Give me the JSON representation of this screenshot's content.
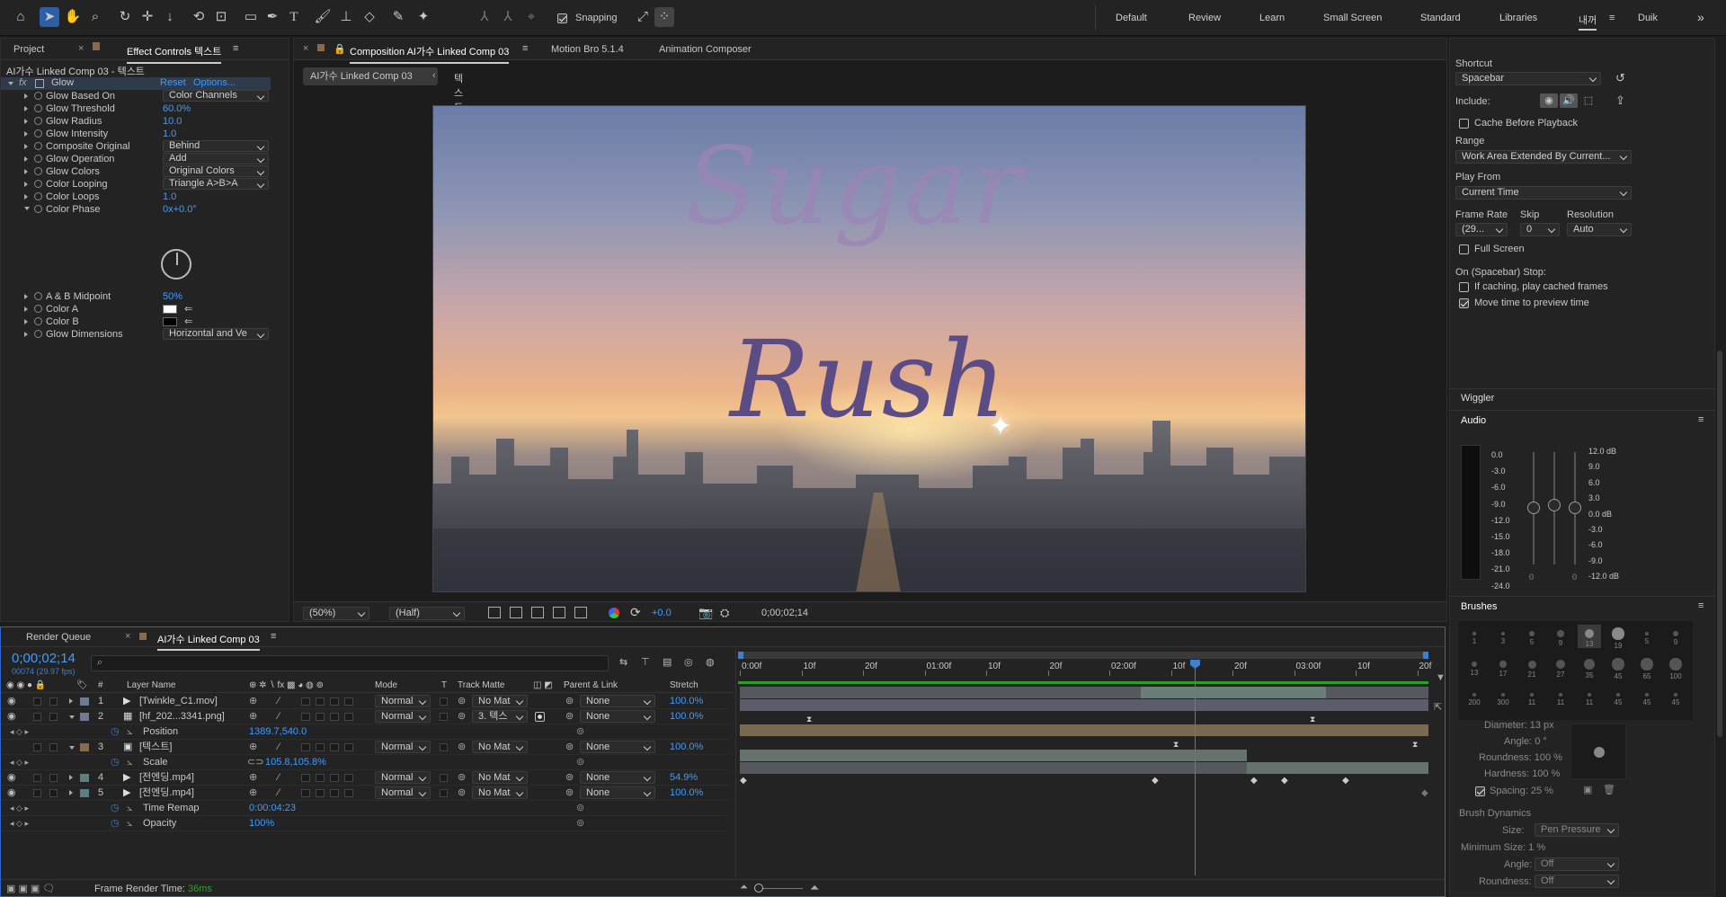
{
  "toolbar": {
    "snapping": "Snapping",
    "workspaces": [
      "Default",
      "Review",
      "Learn",
      "Small Screen",
      "Standard",
      "Libraries",
      "내꺼",
      "Duik"
    ],
    "more": "»"
  },
  "left": {
    "tab_project": "Project",
    "tab_ec": "Effect Controls 텍스트",
    "ec_title": "AI가수 Linked Comp 03 - 텍스트",
    "effect": "Glow",
    "reset": "Reset",
    "options": "Options...",
    "rows": [
      {
        "label": "Glow Based On",
        "value": "Color Channels",
        "type": "dd"
      },
      {
        "label": "Glow Threshold",
        "value": "60.0%",
        "type": "num"
      },
      {
        "label": "Glow Radius",
        "value": "10.0",
        "type": "num"
      },
      {
        "label": "Glow Intensity",
        "value": "1.0",
        "type": "num"
      },
      {
        "label": "Composite Original",
        "value": "Behind",
        "type": "dd"
      },
      {
        "label": "Glow Operation",
        "value": "Add",
        "type": "dd"
      },
      {
        "label": "Glow Colors",
        "value": "Original Colors",
        "type": "dd"
      },
      {
        "label": "Color Looping",
        "value": "Triangle A>B>A",
        "type": "dd"
      },
      {
        "label": "Color Loops",
        "value": "1.0",
        "type": "num"
      },
      {
        "label": "Color Phase",
        "value": "0x+0.0°",
        "type": "num"
      }
    ],
    "rows2": [
      {
        "label": "A & B Midpoint",
        "value": "50%",
        "type": "num"
      },
      {
        "label": "Color A",
        "value": "",
        "type": "colorA"
      },
      {
        "label": "Color B",
        "value": "",
        "type": "colorB"
      },
      {
        "label": "Glow Dimensions",
        "value": "Horizontal and Ve",
        "type": "dd"
      }
    ]
  },
  "comp": {
    "tab": "Composition AI가수 Linked Comp 03",
    "tab2": "Motion Bro 5.1.4",
    "tab3": "Animation Composer",
    "crumb1": "AI가수 Linked Comp 03",
    "crumb2": "텍스트",
    "text1": "Sugar",
    "text2": "Rush",
    "zoom": "(50%)",
    "res": "(Half)",
    "exposure": "+0.0",
    "timecode": "0;00;02;14"
  },
  "right": {
    "shortcut_label": "Shortcut",
    "shortcut": "Spacebar",
    "include": "Include:",
    "cache": "Cache Before Playback",
    "range_label": "Range",
    "range": "Work Area Extended By Current...",
    "playfrom_label": "Play From",
    "playfrom": "Current Time",
    "fr_label": "Frame Rate",
    "fr": "(29...",
    "skip_label": "Skip",
    "skip": "0",
    "resl_label": "Resolution",
    "resl": "Auto",
    "fullscreen": "Full Screen",
    "stop_label": "On (Spacebar) Stop:",
    "opt1": "If caching, play cached frames",
    "opt2": "Move time to preview time",
    "wiggler": "Wiggler",
    "audio": "Audio",
    "audio_left": [
      "0.0",
      "-3.0",
      "-6.0",
      "-9.0",
      "-12.0",
      "-15.0",
      "-18.0",
      "-21.0",
      "-24.0"
    ],
    "audio_right": [
      "12.0 dB",
      "9.0",
      "6.0",
      "3.0",
      "0.0 dB",
      "-3.0",
      "-6.0",
      "-9.0",
      "-12.0 dB"
    ],
    "audio_zero1": "0",
    "audio_zero2": "0",
    "brushes": "Brushes",
    "brush_sizes": [
      "1",
      "3",
      "5",
      "9",
      "13",
      "19",
      "5",
      "9",
      "13",
      "17",
      "21",
      "27",
      "35",
      "45",
      "65",
      "100",
      "200",
      "300",
      "11",
      "11",
      "11",
      "45",
      "45",
      "45"
    ],
    "diameter": "Diameter: 13 px",
    "angle": "Angle: 0 °",
    "roundness": "Roundness: 100 %",
    "hardness": "Hardness: 100 %",
    "spacing": "Spacing: 25 %",
    "dynamics": "Brush Dynamics",
    "size_label": "Size:",
    "size_val": "Pen Pressure",
    "minsize": "Minimum Size: 1 %",
    "angle_label": "Angle:",
    "angle_val": "Off",
    "round_label": "Roundness:",
    "round_val": "Off"
  },
  "timeline": {
    "tab_rq": "Render Queue",
    "tab_comp": "AI가수 Linked Comp 03",
    "timecode": "0;00;02;14",
    "fps": "00074 (29.97 fps)",
    "cols": {
      "num": "#",
      "name": "Layer Name",
      "mode": "Mode",
      "t": "T",
      "track": "Track Matte",
      "parent": "Parent & Link",
      "stretch": "Stretch"
    },
    "ruler": [
      "0:00f",
      "10f",
      "20f",
      "01:00f",
      "10f",
      "20f",
      "02:00f",
      "10f",
      "20f",
      "03:00f",
      "10f",
      "20f"
    ],
    "layers": [
      {
        "num": "1",
        "name": "[Twinkle_C1.mov]",
        "mode": "Normal",
        "matte": "No Mat",
        "parent": "None",
        "stretch": "100.0%"
      },
      {
        "num": "2",
        "name": "[hf_202...3341.png]",
        "mode": "Normal",
        "matte": "3. 텍스",
        "parent": "None",
        "stretch": "100.0%"
      },
      {
        "prop": "Position",
        "value": "1389.7,540.0"
      },
      {
        "num": "3",
        "name": "[텍스트]",
        "mode": "Normal",
        "matte": "No Mat",
        "parent": "None",
        "stretch": "100.0%"
      },
      {
        "prop": "Scale",
        "value": "105.8,105.8%"
      },
      {
        "num": "4",
        "name": "[전엔딩.mp4]",
        "mode": "Normal",
        "matte": "No Mat",
        "parent": "None",
        "stretch": "54.9%"
      },
      {
        "num": "5",
        "name": "[전엔딩.mp4]",
        "mode": "Normal",
        "matte": "No Mat",
        "parent": "None",
        "stretch": "100.0%"
      },
      {
        "prop": "Time Remap",
        "value": "0:00:04:23"
      },
      {
        "prop": "Opacity",
        "value": "100%"
      }
    ],
    "frame_render_label": "Frame Render Time:",
    "frame_render": "36ms"
  }
}
